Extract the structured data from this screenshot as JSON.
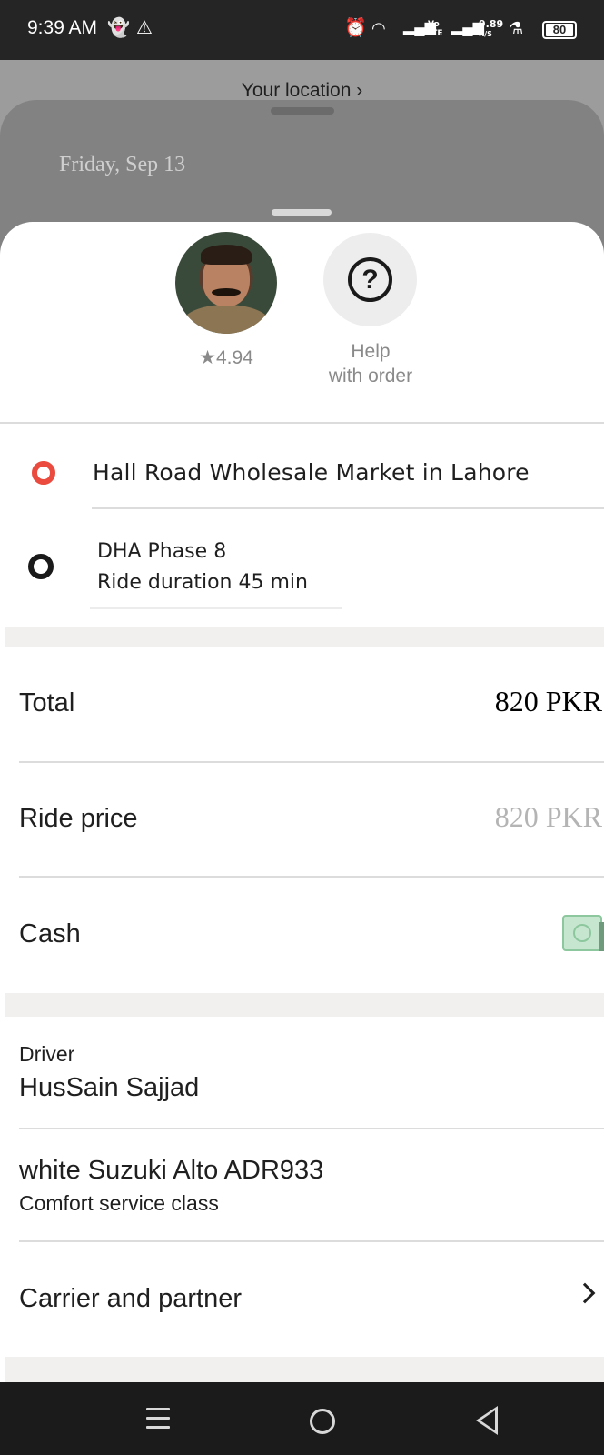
{
  "status_bar": {
    "time": "9:39 AM",
    "icons": [
      "snapchat-icon",
      "alert-icon",
      "alarm-icon",
      "wifi-icon",
      "signal-icon",
      "volte-icon",
      "signal-icon",
      "flask-icon"
    ],
    "volte_text": "Vo\nLTE",
    "speed_value": "9.89",
    "speed_unit": "K/S",
    "battery": "80"
  },
  "background": {
    "location_link": "Your location ›",
    "date": "Friday, Sep 13"
  },
  "driver_header": {
    "rating": "★4.94",
    "help_label": "Help\nwith order"
  },
  "route": {
    "pickup": "Hall Road Wholesale Market in Lahore",
    "dropoff": "DHA Phase 8",
    "duration": "Ride duration 45 min"
  },
  "payment": {
    "total_label": "Total",
    "total_value": "820 PKR",
    "ride_price_label": "Ride price",
    "ride_price_value": "820 PKR",
    "method_label": "Cash",
    "method_icon": "cash-icon"
  },
  "driver": {
    "label": "Driver",
    "name": "HusSain Sajjad",
    "car": "white Suzuki Alto ADR933",
    "service_class": "Comfort service class",
    "carrier_label": "Carrier and partner"
  },
  "colors": {
    "pickup_dot": "#ea4b3e",
    "dropoff_dot": "#1a1a1a",
    "status_bar": "#252525",
    "nav_bar": "#1b1b1b"
  }
}
